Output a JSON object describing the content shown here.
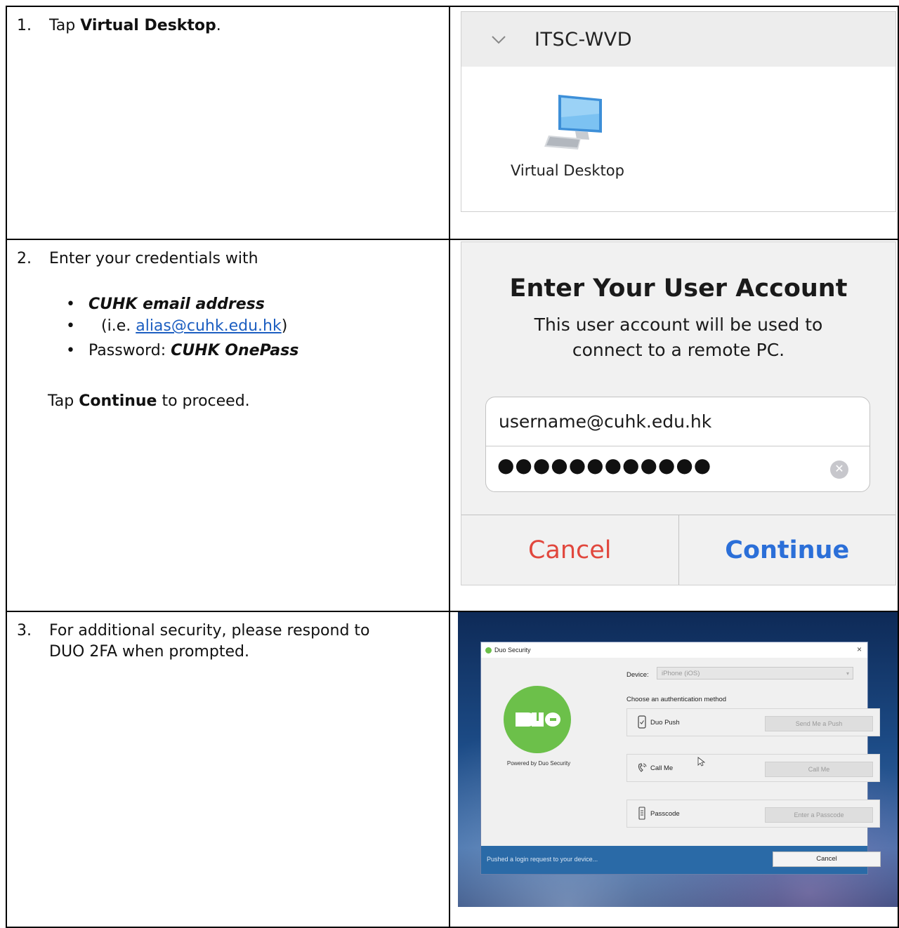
{
  "steps": {
    "s1": {
      "num": "1.",
      "pre": "Tap ",
      "bold": "Virtual Desktop",
      "post": "."
    },
    "s2": {
      "num": "2.",
      "intro": "Enter your credentials with",
      "bullet1": "CUHK email address",
      "bullet1_sub_pre": "(i.e. ",
      "bullet1_sub_link": "alias@cuhk.edu.hk",
      "bullet1_sub_post": ")",
      "bullet2_pre": "Password: ",
      "bullet2_bi": "CUHK OnePass",
      "after_pre": "Tap ",
      "after_bold": "Continue",
      "after_post": " to proceed."
    },
    "s3": {
      "num": "3.",
      "line1": "For additional security, please respond to",
      "line2": "DUO 2FA when prompted."
    }
  },
  "wvd": {
    "title": "ITSC-WVD",
    "item_label": "Virtual Desktop",
    "icon": "monitor-icon"
  },
  "account": {
    "title": "Enter Your User Account",
    "subtitle_l1": "This user account will be used to",
    "subtitle_l2": "connect to a remote PC.",
    "username": "username@cuhk.edu.hk",
    "password_mask": "●●●●●●●●●●●●",
    "cancel": "Cancel",
    "continue": "Continue"
  },
  "duo": {
    "window_title": "Duo Security",
    "close": "×",
    "powered": "Powered by Duo Security",
    "device_label": "Device:",
    "device_value": "iPhone (iOS)",
    "choose": "Choose an authentication method",
    "methods": [
      {
        "label": "Duo Push",
        "button": "Send Me a Push",
        "icon": "phone-push-icon"
      },
      {
        "label": "Call Me",
        "button": "Call Me",
        "icon": "phone-call-icon"
      },
      {
        "label": "Passcode",
        "button": "Enter a Passcode",
        "icon": "passcode-icon"
      }
    ],
    "status": "Pushed a login request to your device...",
    "cancel": "Cancel",
    "colors": {
      "brand_green": "#6cc04a",
      "footer_blue": "#2a6aa7"
    }
  },
  "colors": {
    "cancel_red": "#e1473d",
    "continue_blue": "#2b6fd8",
    "link": "#1d5fc1"
  }
}
